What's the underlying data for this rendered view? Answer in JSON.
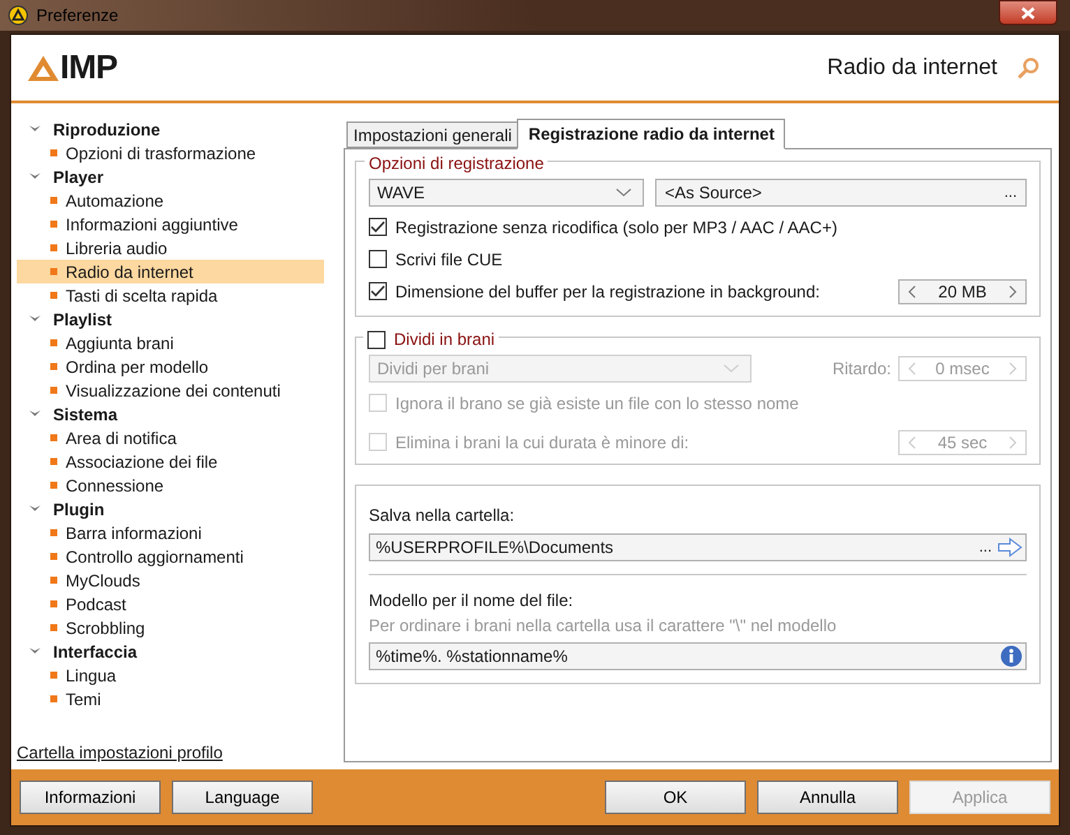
{
  "window": {
    "title": "Preferenze"
  },
  "header": {
    "logo": "IMP",
    "page_title": "Radio da internet"
  },
  "sidebar": {
    "groups": [
      {
        "label": "Riproduzione",
        "expanded": true,
        "children": [
          {
            "label": "Opzioni di trasformazione",
            "selected": false
          }
        ]
      },
      {
        "label": "Player",
        "expanded": true,
        "children": [
          {
            "label": "Automazione",
            "selected": false
          },
          {
            "label": "Informazioni aggiuntive",
            "selected": false
          },
          {
            "label": "Libreria audio",
            "selected": false
          },
          {
            "label": "Radio da internet",
            "selected": true
          },
          {
            "label": "Tasti di scelta rapida",
            "selected": false
          }
        ]
      },
      {
        "label": "Playlist",
        "expanded": true,
        "children": [
          {
            "label": "Aggiunta brani",
            "selected": false
          },
          {
            "label": "Ordina per modello",
            "selected": false
          },
          {
            "label": "Visualizzazione dei contenuti",
            "selected": false
          }
        ]
      },
      {
        "label": "Sistema",
        "expanded": true,
        "children": [
          {
            "label": "Area di notifica",
            "selected": false
          },
          {
            "label": "Associazione dei file",
            "selected": false
          },
          {
            "label": "Connessione",
            "selected": false
          }
        ]
      },
      {
        "label": "Plugin",
        "expanded": true,
        "children": [
          {
            "label": "Barra informazioni",
            "selected": false
          },
          {
            "label": "Controllo aggiornamenti",
            "selected": false
          },
          {
            "label": "MyClouds",
            "selected": false
          },
          {
            "label": "Podcast",
            "selected": false
          },
          {
            "label": "Scrobbling",
            "selected": false
          }
        ]
      },
      {
        "label": "Interfaccia",
        "expanded": true,
        "children": [
          {
            "label": "Lingua",
            "selected": false
          },
          {
            "label": "Temi",
            "selected": false
          }
        ]
      }
    ],
    "profile_link": "Cartella impostazioni profilo"
  },
  "tabs": [
    {
      "label": "Impostazioni generali",
      "selected": false
    },
    {
      "label": "Registrazione radio da internet",
      "selected": true
    }
  ],
  "recording": {
    "legend": "Opzioni di registrazione",
    "format": "WAVE",
    "quality": "<As Source>",
    "quality_button": "...",
    "options": [
      {
        "label": "Registrazione senza ricodifica (solo per MP3 / AAC / AAC+)",
        "checked": true
      },
      {
        "label": "Scrivi file CUE",
        "checked": false
      },
      {
        "label": "Dimensione del buffer per la registrazione in background:",
        "checked": true,
        "spin": "20 MB"
      }
    ]
  },
  "split": {
    "label": "Dividi in brani",
    "checked": false,
    "mode": "Dividi per brani",
    "delay_label": "Ritardo:",
    "delay": "0 msec",
    "options": [
      {
        "label": "Ignora il brano se già esiste un file con lo stesso nome",
        "checked": false
      },
      {
        "label": "Elimina i brani la cui durata è minore di:",
        "checked": false,
        "spin": "45 sec"
      }
    ]
  },
  "save": {
    "folder_label": "Salva nella cartella:",
    "folder": "%USERPROFILE%\\Documents",
    "browse": "...",
    "template_label": "Modello per il nome del file:",
    "template_hint": "Per ordinare i brani nella cartella usa il carattere \"\\\" nel modello",
    "template": "%time%. %stationname%"
  },
  "buttons_left": [
    {
      "label": "Informazioni",
      "disabled": false
    },
    {
      "label": "Language",
      "disabled": false
    }
  ],
  "buttons_right": [
    {
      "label": "OK",
      "disabled": false
    },
    {
      "label": "Annulla",
      "disabled": false
    },
    {
      "label": "Applica",
      "disabled": true
    }
  ]
}
